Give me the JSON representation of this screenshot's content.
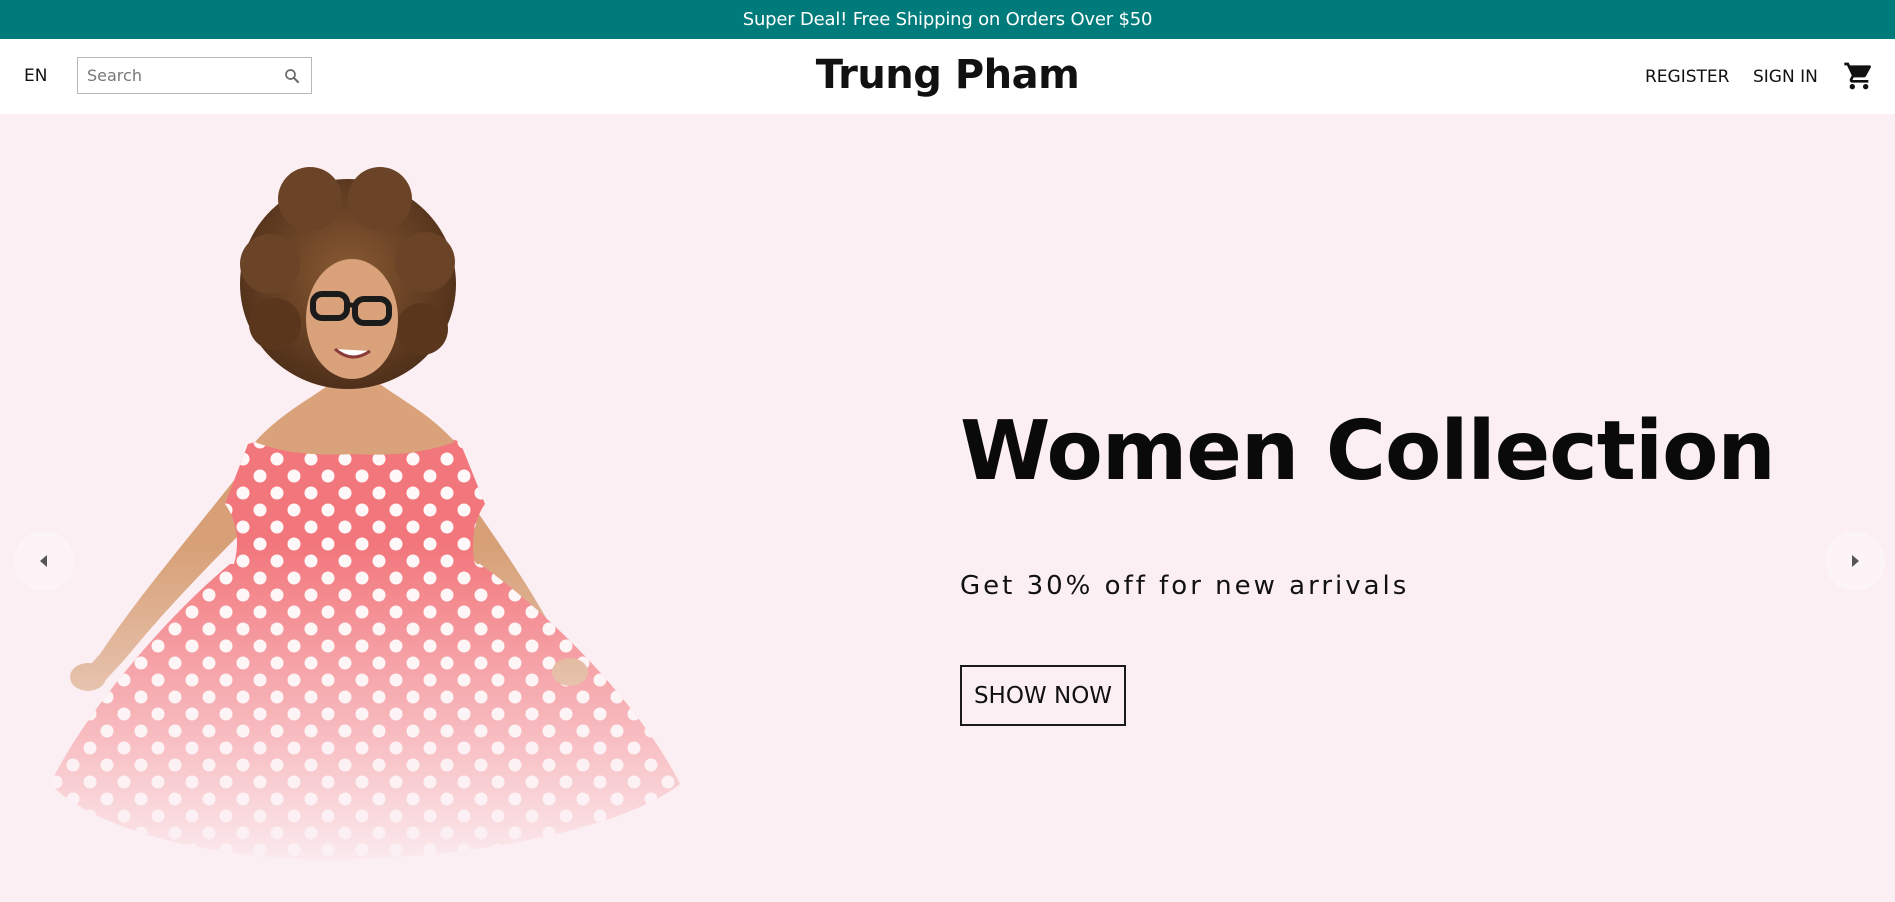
{
  "announcement": {
    "text": "Super Deal! Free Shipping on Orders Over $50"
  },
  "header": {
    "language": "EN",
    "search": {
      "placeholder": "Search",
      "value": ""
    },
    "brand": "Trung Pham",
    "register_label": "REGISTER",
    "signin_label": "SIGN IN",
    "icons": {
      "search": "search-icon",
      "cart": "shopping-cart-icon"
    }
  },
  "hero": {
    "title": "Women Collection",
    "subtitle": "Get 30% off for new arrivals",
    "button_label": "SHOW NOW",
    "image": "woman-in-polka-dot-dress",
    "icons": {
      "prev": "arrow-left-icon",
      "next": "arrow-right-icon"
    }
  },
  "colors": {
    "announcement_bg": "#007b7b",
    "hero_bg": "#fbeff3",
    "dress": "#f2777c"
  }
}
